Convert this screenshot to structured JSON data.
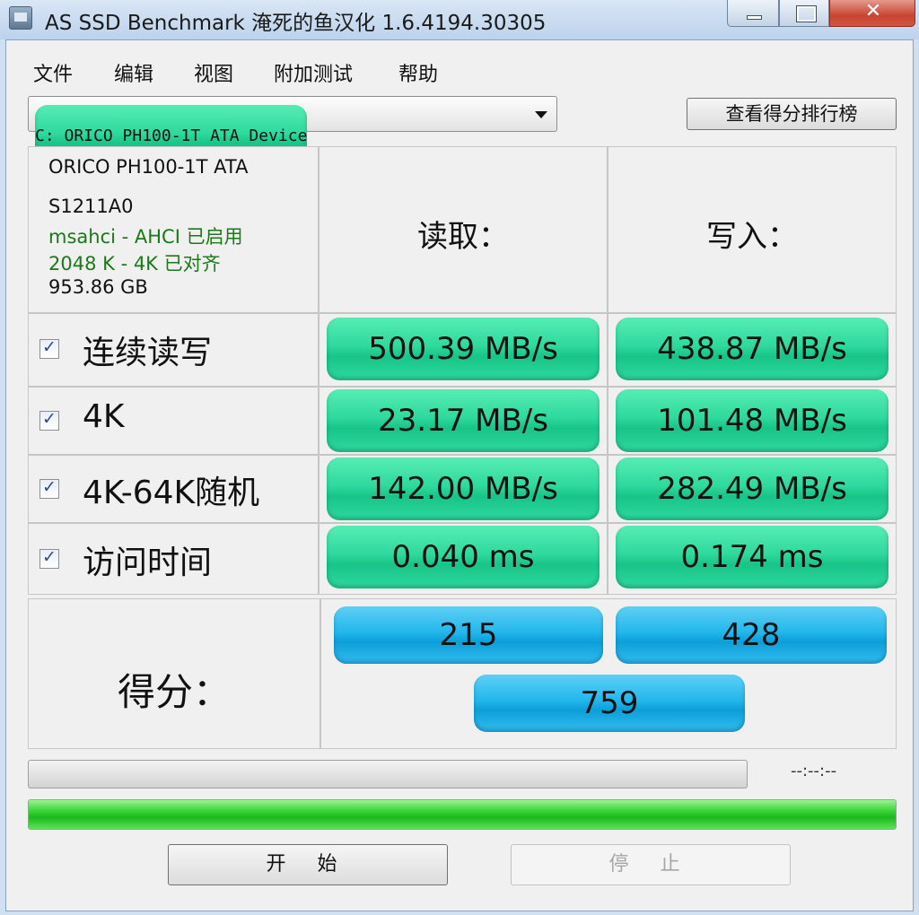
{
  "window": {
    "title": "AS SSD Benchmark 淹死的鱼汉化 1.6.4194.30305",
    "close_glyph": "✕"
  },
  "menu": [
    "文件",
    "编辑",
    "视图",
    "附加测试",
    "帮助"
  ],
  "device": {
    "selected": "C: ORICO PH100-1T ATA Device"
  },
  "rank_button": "查看得分排行榜",
  "info": {
    "model": "ORICO PH100-1T ATA",
    "firmware": "S1211A0",
    "driver": "msahci - AHCI 已启用",
    "alignment": "2048 K - 4K 已对齐",
    "capacity": "953.86 GB"
  },
  "columns": {
    "read": "读取：",
    "write": "写入："
  },
  "rows": [
    {
      "label": "连续读写",
      "read": "500.39 MB/s",
      "write": "438.87 MB/s",
      "checked": true
    },
    {
      "label": "4K",
      "read": "23.17 MB/s",
      "write": "101.48 MB/s",
      "checked": true
    },
    {
      "label": "4K-64K随机",
      "read": "142.00 MB/s",
      "write": "282.49 MB/s",
      "checked": true
    },
    {
      "label": "访问时间",
      "read": "0.040 ms",
      "write": "0.174 ms",
      "checked": true
    }
  ],
  "score": {
    "label": "得分：",
    "read": "215",
    "write": "428",
    "total": "759"
  },
  "progress": {
    "timer": "--:--:--",
    "completion": 1.0
  },
  "buttons": {
    "start": "开 始",
    "stop": "停 止"
  },
  "colors": {
    "value_green": "#2fd99f",
    "score_blue": "#22b7ec",
    "progress_green": "#1cb81c",
    "info_green": "#1a7a18"
  }
}
